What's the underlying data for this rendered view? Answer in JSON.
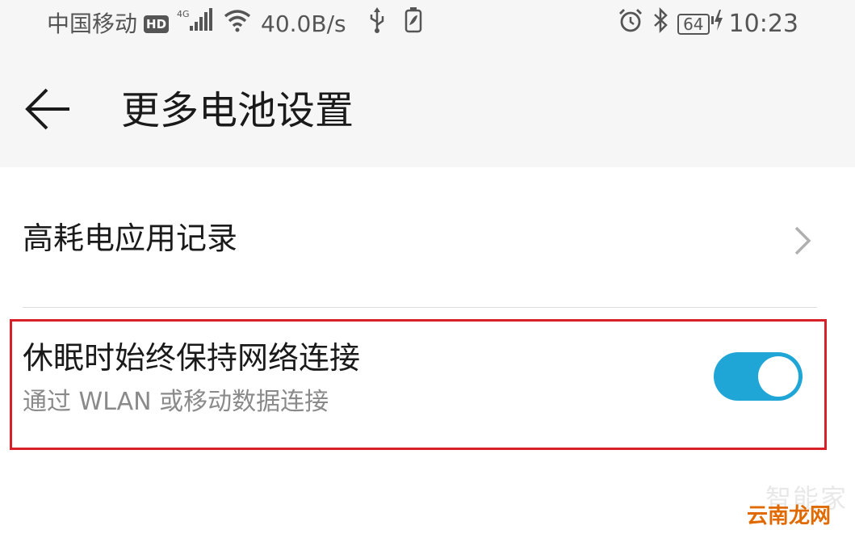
{
  "status_bar": {
    "carrier": "中国移动",
    "hd_badge": "HD",
    "network_type": "4G",
    "speed": "40.0B/s",
    "battery_level": "64",
    "time": "10:23",
    "icons": [
      "signal-icon",
      "wifi-icon",
      "usb-icon",
      "battery-saver-icon",
      "alarm-icon",
      "bluetooth-icon",
      "battery-icon",
      "charging-icon"
    ]
  },
  "header": {
    "title": "更多电池设置",
    "back_icon": "back-arrow-icon"
  },
  "settings": {
    "power_apps": {
      "label": "高耗电应用记录",
      "icon": "chevron-right-icon"
    },
    "keep_network": {
      "label": "休眠时始终保持网络连接",
      "subtitle": "通过 WLAN 或移动数据连接",
      "enabled": true
    }
  },
  "watermark": {
    "line1": "智能家",
    "line2": "云南龙网"
  },
  "colors": {
    "toggle_on": "#1fa6d6",
    "highlight_border": "#d8202a",
    "header_bg": "#f6f6f6"
  }
}
